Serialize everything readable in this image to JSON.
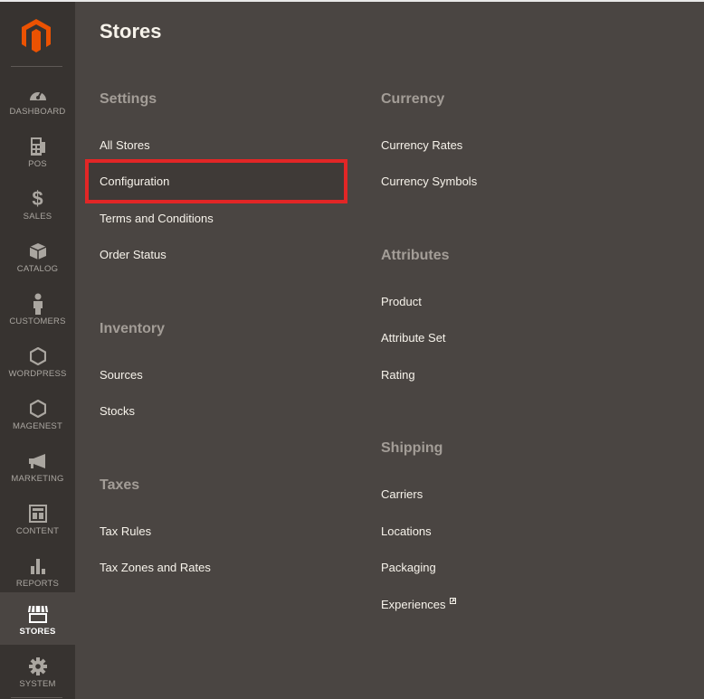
{
  "sidebar": {
    "items": [
      {
        "label": "DASHBOARD",
        "icon": "dashboard-icon"
      },
      {
        "label": "POS",
        "icon": "pos-icon"
      },
      {
        "label": "SALES",
        "icon": "dollar-icon"
      },
      {
        "label": "CATALOG",
        "icon": "box-icon"
      },
      {
        "label": "CUSTOMERS",
        "icon": "person-icon"
      },
      {
        "label": "WORDPRESS",
        "icon": "hexagon-icon"
      },
      {
        "label": "MAGENEST",
        "icon": "hexagon-icon"
      },
      {
        "label": "MARKETING",
        "icon": "megaphone-icon"
      },
      {
        "label": "CONTENT",
        "icon": "layout-icon"
      },
      {
        "label": "REPORTS",
        "icon": "bar-chart-icon"
      },
      {
        "label": "STORES",
        "icon": "storefront-icon"
      },
      {
        "label": "SYSTEM",
        "icon": "gear-icon"
      }
    ],
    "active": "STORES",
    "accent_color": "#eb5202"
  },
  "panel": {
    "title": "Stores",
    "sections": {
      "settings": {
        "title": "Settings",
        "links": [
          "All Stores",
          "Configuration",
          "Terms and Conditions",
          "Order Status"
        ]
      },
      "inventory": {
        "title": "Inventory",
        "links": [
          "Sources",
          "Stocks"
        ]
      },
      "taxes": {
        "title": "Taxes",
        "links": [
          "Tax Rules",
          "Tax Zones and Rates"
        ]
      },
      "currency": {
        "title": "Currency",
        "links": [
          "Currency Rates",
          "Currency Symbols"
        ]
      },
      "attributes": {
        "title": "Attributes",
        "links": [
          "Product",
          "Attribute Set",
          "Rating"
        ]
      },
      "shipping": {
        "title": "Shipping",
        "links": [
          "Carriers",
          "Locations",
          "Packaging",
          "Experiences"
        ]
      }
    }
  }
}
